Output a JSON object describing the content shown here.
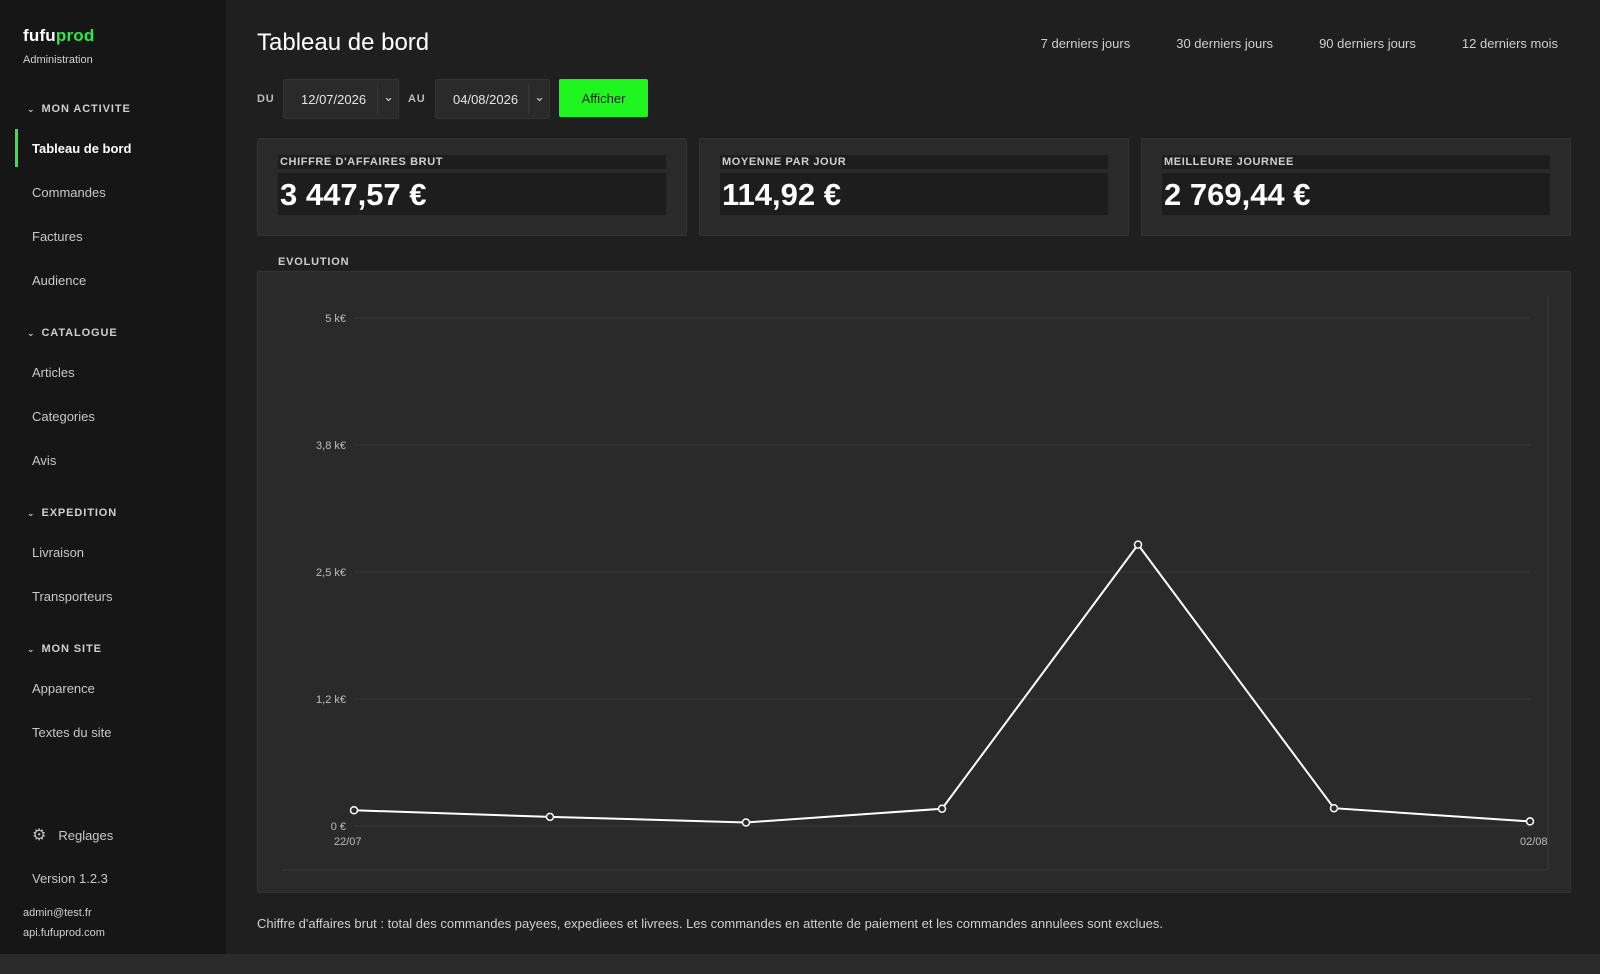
{
  "brand": {
    "name_part1": "fufu",
    "name_part2": "prod",
    "subtitle": "Administration",
    "accent": "#2ee84a"
  },
  "sidebar": {
    "sections": [
      {
        "title": "MON ACTIVITE",
        "items": [
          {
            "label": "Tableau de bord",
            "active": true
          },
          {
            "label": "Commandes"
          },
          {
            "label": "Factures"
          },
          {
            "label": "Audience"
          }
        ]
      },
      {
        "title": "CATALOGUE",
        "items": [
          {
            "label": "Articles"
          },
          {
            "label": "Categories"
          },
          {
            "label": "Avis"
          }
        ]
      },
      {
        "title": "EXPEDITION",
        "items": [
          {
            "label": "Livraison"
          },
          {
            "label": "Transporteurs"
          }
        ]
      },
      {
        "title": "MON SITE",
        "items": [
          {
            "label": "Apparence"
          },
          {
            "label": "Textes du site"
          }
        ]
      }
    ],
    "settings_label": "Reglages",
    "settings_icon": "gear-icon",
    "version": "Version 1.2.3",
    "user_email": "admin@test.fr",
    "api_host": "api.fufuprod.com"
  },
  "header": {
    "title": "Tableau de bord",
    "presets": [
      "7 derniers jours",
      "30 derniers jours",
      "90 derniers jours",
      "12 derniers mois"
    ]
  },
  "filter": {
    "from_label": "DU",
    "from_value": "12/07/2026",
    "to_label": "AU",
    "to_value": "04/08/2026",
    "submit_label": "Afficher",
    "submit_color": "#1ff51f"
  },
  "kpis": [
    {
      "label": "CHIFFRE D'AFFAIRES BRUT",
      "value": "3 447,57 €"
    },
    {
      "label": "MOYENNE PAR JOUR",
      "value": "114,92 €"
    },
    {
      "label": "MEILLEURE JOURNEE",
      "value": "2 769,44 €"
    }
  ],
  "evolution_label": "EVOLUTION",
  "chart_data": {
    "type": "line",
    "title": "",
    "xlabel": "",
    "ylabel": "",
    "x_tick_labels": [
      "22/07",
      "02/08"
    ],
    "y_tick_labels": [
      "0 €",
      "1,2 k€",
      "2,5 k€",
      "3,8 k€",
      "5 k€"
    ],
    "y_ticks": [
      0,
      1250,
      2500,
      3750,
      5000
    ],
    "ylim": [
      0,
      5000
    ],
    "grid": true,
    "legend": "none",
    "line_color": "#ffffff",
    "series": [
      {
        "values": [
          155,
          90,
          35,
          170,
          2769.44,
          175,
          45
        ]
      }
    ]
  },
  "footnote": "Chiffre d'affaires brut : total des commandes payees, expediees et livrees. Les commandes en attente de paiement et les commandes annulees sont exclues."
}
